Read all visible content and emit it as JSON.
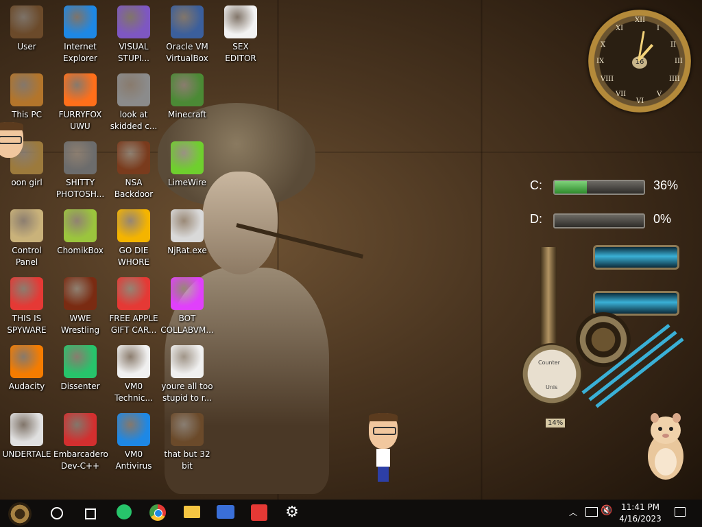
{
  "desktop": {
    "icons": [
      {
        "label": "User",
        "col": 0,
        "row": 0,
        "icon": "user-folder-icon",
        "color": "#6b4a2a"
      },
      {
        "label": "Internet\nExplorer",
        "col": 1,
        "row": 0,
        "icon": "edge-browser-icon",
        "color": "#1e88e5"
      },
      {
        "label": "VISUAL\nSTUPI...",
        "col": 2,
        "row": 0,
        "icon": "visual-studio-icon",
        "color": "#7e57c2"
      },
      {
        "label": "Oracle VM\nVirtualBox",
        "col": 3,
        "row": 0,
        "icon": "virtualbox-icon",
        "color": "#3b5f9c"
      },
      {
        "label": "SEX\nEDITOR",
        "col": 4,
        "row": 0,
        "icon": "hex-editor-icon",
        "color": "#f2f2f2"
      },
      {
        "label": "This PC",
        "col": 0,
        "row": 1,
        "icon": "computer-icon",
        "color": "#b3752b"
      },
      {
        "label": "FURRYFOX\nUWU",
        "col": 1,
        "row": 1,
        "icon": "firefox-icon",
        "color": "#ff6f1a"
      },
      {
        "label": "look at\nskidded c...",
        "col": 2,
        "row": 1,
        "icon": "shortcut-stack-icon",
        "color": "#8b8b8b"
      },
      {
        "label": "Minecraft",
        "col": 3,
        "row": 1,
        "icon": "minecraft-icon",
        "color": "#4b8a35"
      },
      {
        "label": "oon girl",
        "col": 0,
        "row": 2,
        "icon": "folder-icon",
        "color": "#9c7a3c"
      },
      {
        "label": "SHITTY\nPHOTOSH...",
        "col": 1,
        "row": 2,
        "icon": "gimp-icon",
        "color": "#6c6c6c"
      },
      {
        "label": "NSA\nBackdoor",
        "col": 2,
        "row": 2,
        "icon": "framed-picture-icon",
        "color": "#7a3b1d"
      },
      {
        "label": "LimeWire",
        "col": 3,
        "row": 2,
        "icon": "limewire-icon",
        "color": "#6fcf2e"
      },
      {
        "label": "Control Panel",
        "col": 0,
        "row": 3,
        "icon": "lightbulb-icon",
        "color": "#c9b27a"
      },
      {
        "label": "ChomikBox",
        "col": 1,
        "row": 3,
        "icon": "chomikbox-icon",
        "color": "#9bc53d"
      },
      {
        "label": "GO DIE\nWHORE",
        "col": 2,
        "row": 3,
        "icon": "de-logo-icon",
        "color": "#f4b400"
      },
      {
        "label": "NjRat.exe",
        "col": 3,
        "row": 3,
        "icon": "skull-icon",
        "color": "#d9d9d9"
      },
      {
        "label": "THIS IS\nSPYWARE",
        "col": 0,
        "row": 4,
        "icon": "chrome-icon",
        "color": "#e53935"
      },
      {
        "label": "WWE\nWrestling",
        "col": 1,
        "row": 4,
        "icon": "tv-icon",
        "color": "#7a2b12"
      },
      {
        "label": "FREE APPLE\nGIFT CAR...",
        "col": 2,
        "row": 4,
        "icon": "apple-icon",
        "color": "#e53935"
      },
      {
        "label": "BOT\nCOLLABVM...",
        "col": 3,
        "row": 4,
        "icon": "monitor-icon",
        "color": "#e040fb"
      },
      {
        "label": "Audacity",
        "col": 0,
        "row": 5,
        "icon": "audacity-icon",
        "color": "#f57c00"
      },
      {
        "label": "Dissenter",
        "col": 1,
        "row": 5,
        "icon": "dissenter-icon",
        "color": "#27c46b"
      },
      {
        "label": "VM0\nTechnic...",
        "col": 2,
        "row": 5,
        "icon": "technician-icon",
        "color": "#f0f0f0"
      },
      {
        "label": "youre all too\nstupid to r...",
        "col": 3,
        "row": 5,
        "icon": "portrait-icon",
        "color": "#f0f0f0"
      },
      {
        "label": "UNDERTALE",
        "col": 0,
        "row": 6,
        "icon": "unity-icon",
        "color": "#e0e0e0"
      },
      {
        "label": "Embarcadero\nDev-C++",
        "col": 1,
        "row": 6,
        "icon": "devcpp-icon",
        "color": "#d32f2f"
      },
      {
        "label": "VM0\nAntivirus",
        "col": 2,
        "row": 6,
        "icon": "shield-icon",
        "color": "#1e88e5"
      },
      {
        "label": "that but 32\nbit",
        "col": 3,
        "row": 6,
        "icon": "portrait-icon",
        "color": "#6b4a2a"
      }
    ]
  },
  "widgets": {
    "clock": {
      "date_number": "16",
      "numerals": [
        "XII",
        "I",
        "II",
        "III",
        "IIII",
        "V",
        "VI",
        "VII",
        "VIII",
        "IX",
        "X",
        "XI"
      ]
    },
    "drives": [
      {
        "letter": "C:",
        "percent_label": "36%",
        "fill": 0.36
      },
      {
        "letter": "D:",
        "percent_label": "0%",
        "fill": 0.0
      }
    ],
    "gauge_value": "14%",
    "gauge_text_top": "Counter",
    "gauge_text_bottom": "Unis"
  },
  "taskbar": {
    "apps": [
      {
        "name": "start-button",
        "icon": "steampunk-orb-icon"
      },
      {
        "name": "cortana-button",
        "icon": "circle-icon"
      },
      {
        "name": "task-view-button",
        "icon": "task-view-icon"
      },
      {
        "name": "dissenter-taskbar",
        "icon": "dissenter-icon"
      },
      {
        "name": "chrome-taskbar",
        "icon": "chrome-icon"
      },
      {
        "name": "file-explorer-taskbar",
        "icon": "folder-icon"
      },
      {
        "name": "keyboard-taskbar",
        "icon": "keyboard-icon"
      },
      {
        "name": "anydesk-taskbar",
        "icon": "anydesk-icon"
      },
      {
        "name": "settings-taskbar",
        "icon": "gear-icon"
      }
    ],
    "time": "11:41 PM",
    "date": "4/16/2023"
  }
}
